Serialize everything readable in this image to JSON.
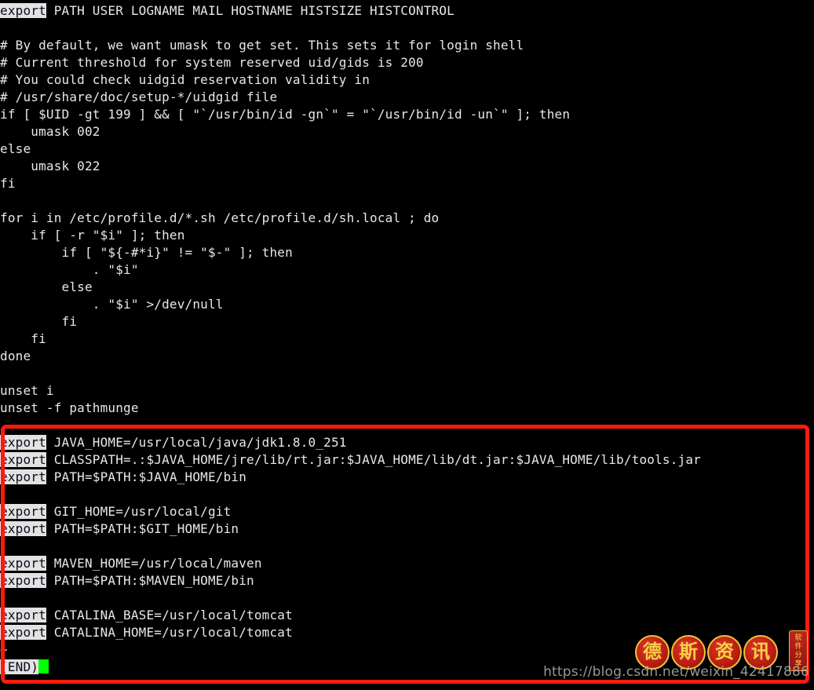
{
  "terminal": {
    "pager": "less",
    "file_content_lines": [
      {
        "id": "l1",
        "highlight": "export",
        "rest": " PATH USER LOGNAME MAIL HOSTNAME HISTSIZE HISTCONTROL"
      },
      {
        "id": "l2",
        "text": ""
      },
      {
        "id": "l3",
        "text": "# By default, we want umask to get set. This sets it for login shell"
      },
      {
        "id": "l4",
        "text": "# Current threshold for system reserved uid/gids is 200"
      },
      {
        "id": "l5",
        "text": "# You could check uidgid reservation validity in"
      },
      {
        "id": "l6",
        "text": "# /usr/share/doc/setup-*/uidgid file"
      },
      {
        "id": "l7",
        "text": "if [ $UID -gt 199 ] && [ \"`/usr/bin/id -gn`\" = \"`/usr/bin/id -un`\" ]; then"
      },
      {
        "id": "l8",
        "text": "    umask 002"
      },
      {
        "id": "l9",
        "text": "else"
      },
      {
        "id": "l10",
        "text": "    umask 022"
      },
      {
        "id": "l11",
        "text": "fi"
      },
      {
        "id": "l12",
        "text": ""
      },
      {
        "id": "l13",
        "text": "for i in /etc/profile.d/*.sh /etc/profile.d/sh.local ; do"
      },
      {
        "id": "l14",
        "text": "    if [ -r \"$i\" ]; then"
      },
      {
        "id": "l15",
        "text": "        if [ \"${-#*i}\" != \"$-\" ]; then"
      },
      {
        "id": "l16",
        "text": "            . \"$i\""
      },
      {
        "id": "l17",
        "text": "        else"
      },
      {
        "id": "l18",
        "text": "            . \"$i\" >/dev/null"
      },
      {
        "id": "l19",
        "text": "        fi"
      },
      {
        "id": "l20",
        "text": "    fi"
      },
      {
        "id": "l21",
        "text": "done"
      },
      {
        "id": "l22",
        "text": ""
      },
      {
        "id": "l23",
        "text": "unset i"
      },
      {
        "id": "l24",
        "text": "unset -f pathmunge"
      },
      {
        "id": "l25",
        "text": ""
      },
      {
        "id": "l26",
        "highlight": "export",
        "rest": " JAVA_HOME=/usr/local/java/jdk1.8.0_251"
      },
      {
        "id": "l27",
        "highlight": "export",
        "rest": " CLASSPATH=.:$JAVA_HOME/jre/lib/rt.jar:$JAVA_HOME/lib/dt.jar:$JAVA_HOME/lib/tools.jar"
      },
      {
        "id": "l28",
        "highlight": "export",
        "rest": " PATH=$PATH:$JAVA_HOME/bin"
      },
      {
        "id": "l29",
        "text": ""
      },
      {
        "id": "l30",
        "highlight": "export",
        "rest": " GIT_HOME=/usr/local/git"
      },
      {
        "id": "l31",
        "highlight": "export",
        "rest": " PATH=$PATH:$GIT_HOME/bin"
      },
      {
        "id": "l32",
        "text": ""
      },
      {
        "id": "l33",
        "highlight": "export",
        "rest": " MAVEN_HOME=/usr/local/maven"
      },
      {
        "id": "l34",
        "highlight": "export",
        "rest": " PATH=$PATH:$MAVEN_HOME/bin"
      },
      {
        "id": "l35",
        "text": ""
      },
      {
        "id": "l36",
        "highlight": "export",
        "rest": " CATALINA_BASE=/usr/local/tomcat"
      },
      {
        "id": "l37",
        "highlight": "export",
        "rest": " CATALINA_HOME=/usr/local/tomcat"
      },
      {
        "id": "l38",
        "text": "~"
      }
    ],
    "status_line": {
      "label": "(END)",
      "cursor_color": "#00ff00"
    },
    "colors": {
      "background": "#000000",
      "foreground": "#e8e8e8",
      "highlight_bg": "#e2e2e2",
      "highlight_fg": "#0a0a1e",
      "cursor": "#00ff00"
    }
  },
  "annotation": {
    "shape": "rectangle",
    "color": "#fe1a0c",
    "border_width_px": 5
  },
  "watermark": {
    "url": "https://blog.csdn.net/weixin_42417886",
    "seals": [
      "德",
      "斯",
      "资",
      "讯"
    ],
    "banner": [
      "软",
      "件",
      "分",
      "享"
    ]
  }
}
